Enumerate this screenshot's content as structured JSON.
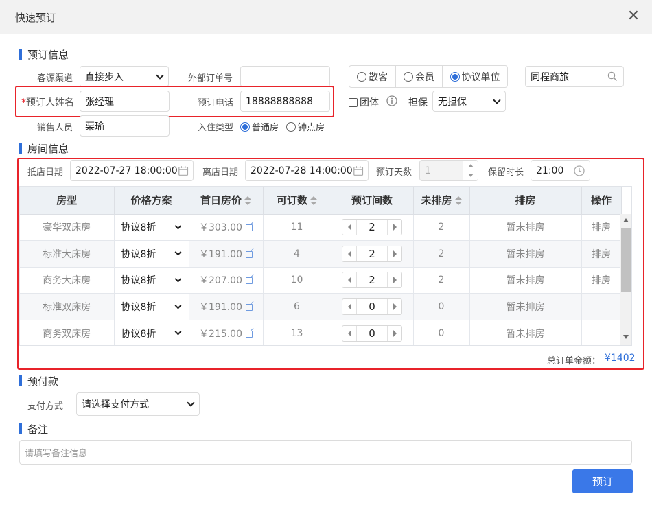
{
  "dialog": {
    "title": "快速预订",
    "close_icon": "close-icon"
  },
  "booking_info": {
    "section_title": "预订信息",
    "channel_label": "客源渠道",
    "channel_value": "直接步入",
    "external_order_label": "外部订单号",
    "external_order_value": "",
    "guest_type_options": [
      "散客",
      "会员",
      "协议单位"
    ],
    "guest_type_selected": "协议单位",
    "company_value": "同程商旅",
    "booker_required_mark": "*",
    "booker_label": "预订人姓名",
    "booker_value": "张经理",
    "phone_label": "预订电话",
    "phone_value": "18888888888",
    "group_label": "团体",
    "guarantee_label": "担保",
    "guarantee_value": "无担保",
    "sales_label": "销售人员",
    "sales_value": "栗瑜",
    "checkin_type_label": "入住类型",
    "checkin_type_options": [
      "普通房",
      "钟点房"
    ],
    "checkin_type_selected": "普通房"
  },
  "room_info": {
    "section_title": "房间信息",
    "arrival_label": "抵店日期",
    "arrival_value": "2022-07-27 18:00:00",
    "departure_label": "离店日期",
    "departure_value": "2022-07-28 14:00:00",
    "days_label": "预订天数",
    "days_value": "1",
    "hold_label": "保留时长",
    "hold_value": "21:00",
    "columns": [
      "房型",
      "价格方案",
      "首日房价",
      "可订数",
      "预订间数",
      "未排房",
      "排房",
      "操作"
    ],
    "rows": [
      {
        "room_type": "豪华双床房",
        "plan": "协议8折",
        "price": "￥303.00",
        "available": "11",
        "qty": "2",
        "unassigned": "2",
        "assign": "暂未排房",
        "action": "排房"
      },
      {
        "room_type": "标准大床房",
        "plan": "协议8折",
        "price": "￥191.00",
        "available": "4",
        "qty": "2",
        "unassigned": "2",
        "assign": "暂未排房",
        "action": "排房"
      },
      {
        "room_type": "商务大床房",
        "plan": "协议8折",
        "price": "￥207.00",
        "available": "10",
        "qty": "2",
        "unassigned": "2",
        "assign": "暂未排房",
        "action": "排房"
      },
      {
        "room_type": "标准双床房",
        "plan": "协议8折",
        "price": "￥191.00",
        "available": "6",
        "qty": "0",
        "unassigned": "0",
        "assign": "暂未排房",
        "action": ""
      },
      {
        "room_type": "商务双床房",
        "plan": "协议8折",
        "price": "￥215.00",
        "available": "13",
        "qty": "0",
        "unassigned": "0",
        "assign": "暂未排房",
        "action": ""
      }
    ],
    "total_label": "总订单金额：",
    "total_value": "¥1402"
  },
  "prepay": {
    "section_title": "预付款",
    "method_label": "支付方式",
    "method_value": "请选择支付方式"
  },
  "remarks": {
    "section_title": "备注",
    "placeholder": "请填写备注信息"
  },
  "submit_label": "预订",
  "colors": {
    "accent": "#3a78e8",
    "highlight_border": "#e8232a",
    "header_bg": "#edf1f5"
  }
}
